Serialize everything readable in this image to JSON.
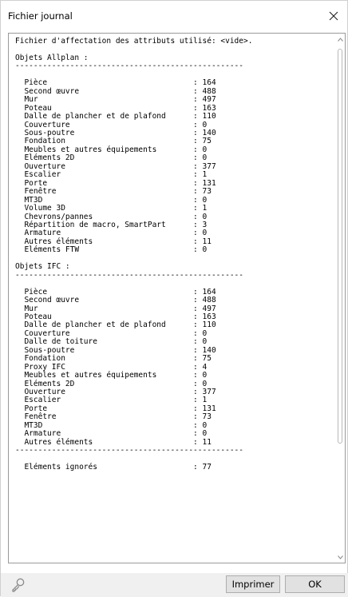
{
  "window": {
    "title": "Fichier journal",
    "close_icon": "close-icon"
  },
  "log": {
    "lines": [
      "Fichier d'affectation des attributs utilisé: <vide>.",
      "",
      "Objets Allplan :",
      "--------------------------------------------------",
      "",
      "  Pièce                                : 164",
      "  Second œuvre                         : 488",
      "  Mur                                  : 497",
      "  Poteau                               : 163",
      "  Dalle de plancher et de plafond      : 110",
      "  Couverture                           : 0",
      "  Sous-poutre                          : 140",
      "  Fondation                            : 75",
      "  Meubles et autres équipements        : 0",
      "  Eléments 2D                          : 0",
      "  Ouverture                            : 377",
      "  Escalier                             : 1",
      "  Porte                                : 131",
      "  Fenêtre                              : 73",
      "  MT3D                                 : 0",
      "  Volume 3D                            : 1",
      "  Chevrons/pannes                      : 0",
      "  Répartition de macro, SmartPart      : 3",
      "  Armature                             : 0",
      "  Autres éléments                      : 11",
      "  Eléments FTW                         : 0",
      "",
      "Objets IFC :",
      "--------------------------------------------------",
      "",
      "  Pièce                                : 164",
      "  Second œuvre                         : 488",
      "  Mur                                  : 497",
      "  Poteau                               : 163",
      "  Dalle de plancher et de plafond      : 110",
      "  Couverture                           : 0",
      "  Dalle de toiture                     : 0",
      "  Sous-poutre                          : 140",
      "  Fondation                            : 75",
      "  Proxy IFC                            : 4",
      "  Meubles et autres équipements        : 0",
      "  Eléments 2D                          : 0",
      "  Ouverture                            : 377",
      "  Escalier                             : 1",
      "  Porte                                : 131",
      "  Fenêtre                              : 73",
      "  MT3D                                 : 0",
      "  Armature                             : 0",
      "  Autres éléments                      : 11",
      "--------------------------------------------------",
      "",
      "  Eléments ignorés                     : 77"
    ]
  },
  "footer": {
    "help_icon": "key-icon",
    "print_label": "Imprimer",
    "ok_label": "OK"
  }
}
